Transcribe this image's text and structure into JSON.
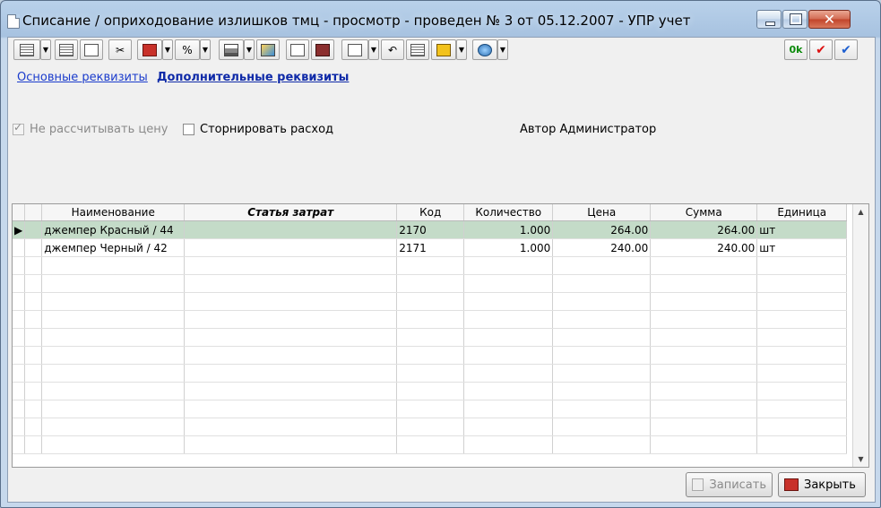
{
  "window": {
    "title": "Списание / оприходование излишков тмц - просмотр - проведен № 3 от 05.12.2007 - УПР учет",
    "controls": {
      "minimize": "",
      "maximize": "",
      "close": "✕"
    }
  },
  "toolbar": {
    "ok_label": "0k",
    "check_red": "✔",
    "check_blue": "✔"
  },
  "tabs": [
    {
      "label": "Основные реквизиты"
    },
    {
      "label": "Дополнительные реквизиты"
    }
  ],
  "form": {
    "no_price_calc": {
      "label": "Не рассчитывать цену",
      "checked": true,
      "disabled": true
    },
    "storno": {
      "label": "Сторнировать расход",
      "checked": false
    },
    "author": "Автор Администратор"
  },
  "grid": {
    "columns": [
      "Наименование",
      "Статья затрат",
      "Код",
      "Количество",
      "Цена",
      "Сумма",
      "Единица"
    ],
    "rows": [
      {
        "name": "джемпер Красный / 44",
        "article": "",
        "code": "2170",
        "qty": "1.000",
        "price": "264.00",
        "sum": "264.00",
        "unit": "шт"
      },
      {
        "name": "джемпер Черный / 42",
        "article": "",
        "code": "2171",
        "qty": "1.000",
        "price": "240.00",
        "sum": "240.00",
        "unit": "шт"
      }
    ],
    "selected_row": 0
  },
  "buttons": {
    "save": "Записать",
    "close": "Закрыть"
  }
}
